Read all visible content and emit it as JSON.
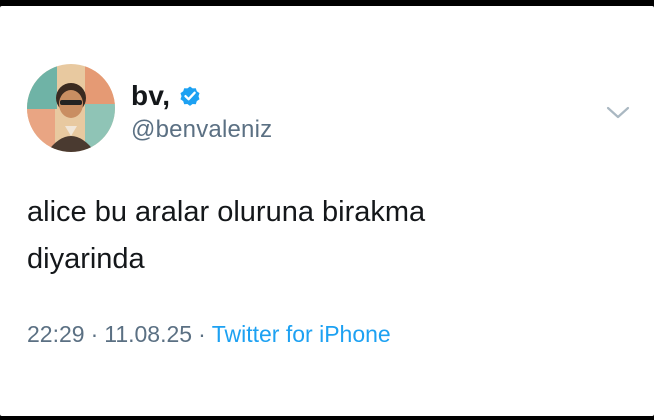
{
  "tweet": {
    "author": {
      "display_name": "bv,",
      "handle": "@benvaleniz",
      "verified": true,
      "avatar_icon": "profile-photo"
    },
    "text_lines": [
      "alice bu aralar oluruna birakma",
      "diyarinda"
    ],
    "time": "22:29",
    "date": "11.08.25",
    "separator": "·",
    "source": "Twitter for iPhone"
  },
  "colors": {
    "background": "#ffffff",
    "frame": "#000000",
    "primary_text": "#14171a",
    "secondary_text": "#5b7083",
    "accent": "#1da1f2",
    "chevron": "#aab8c2"
  }
}
